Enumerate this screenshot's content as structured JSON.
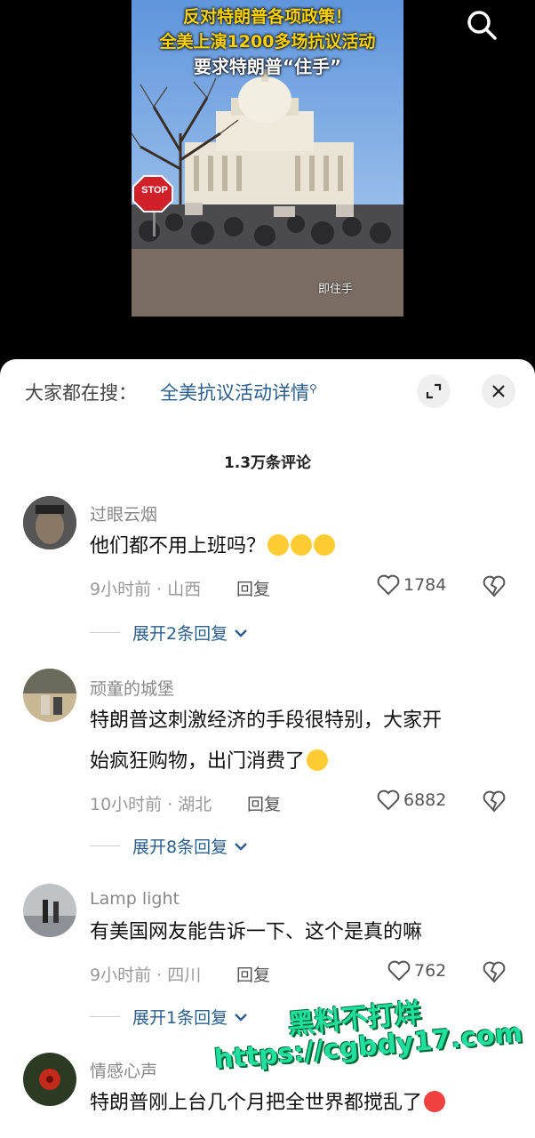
{
  "video": {
    "overlay_line1": "反对特朗普各项政策！",
    "overlay_line2": "全美上演1200多场抗议活动",
    "overlay_line3": "要求特朗普“住手”",
    "sign_text": "STOP",
    "subtitle_right": "即住手"
  },
  "header": {
    "hot_search_label": "大家都在搜：",
    "hot_search_link": "全美抗议活动详情"
  },
  "comments_count": "1.3万条评论",
  "comments": [
    {
      "name": "过眼云烟",
      "text": "他们都不用上班吗？",
      "time_location": "9小时前 · 山西",
      "reply_label": "回复",
      "likes": "1784",
      "expand_label": "展开2条回复"
    },
    {
      "name": "顽童的城堡",
      "text_line1": "特朗普这刺激经济的手段很特别，大家开",
      "text_line2": "始疯狂购物，出门消费了",
      "time_location": "10小时前 · 湖北",
      "reply_label": "回复",
      "likes": "6882",
      "expand_label": "展开8条回复"
    },
    {
      "name": "Lamp light",
      "text": "有美国网友能告诉一下、这个是真的嘛",
      "time_location": "9小时前 · 四川",
      "reply_label": "回复",
      "likes": "762",
      "expand_label": "展开1条回复"
    },
    {
      "name": "情感心声",
      "text": "特朗普刚上台几个月把全世界都搅乱了"
    }
  ],
  "watermark": {
    "line1": "黑料不打烊",
    "line2": "https://cgbdy17.com"
  },
  "colors": {
    "link_blue": "#2b5e8c",
    "overlay_yellow": "#ffd200",
    "watermark_green": "#20e0a0"
  }
}
